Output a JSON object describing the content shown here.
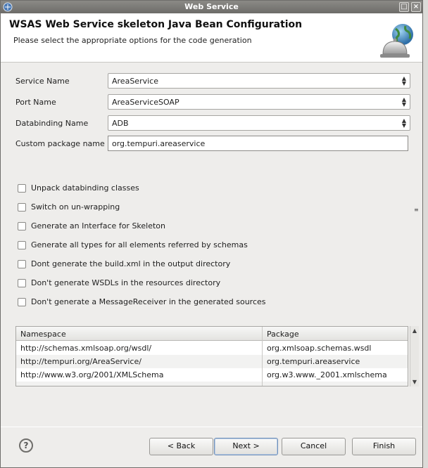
{
  "window": {
    "title": "Web Service"
  },
  "header": {
    "title": "WSAS Web Service skeleton Java Bean Configuration",
    "description": "Please select the appropriate options for the code generation"
  },
  "form": {
    "service_name_label": "Service Name",
    "service_name_value": "AreaService",
    "port_name_label": "Port Name",
    "port_name_value": "AreaServiceSOAP",
    "databinding_label": "Databinding Name",
    "databinding_value": "ADB",
    "package_label": "Custom package name",
    "package_value": "org.tempuri.areaservice"
  },
  "options": [
    {
      "label": "Unpack databinding classes",
      "checked": false
    },
    {
      "label": "Switch on un-wrapping",
      "checked": false
    },
    {
      "label": "Generate an Interface for Skeleton",
      "checked": false
    },
    {
      "label": "Generate all types for all elements referred by schemas",
      "checked": false
    },
    {
      "label": "Dont generate the build.xml in the output directory",
      "checked": false
    },
    {
      "label": "Don't generate WSDLs in the resources directory",
      "checked": false
    },
    {
      "label": "Don't generate a MessageReceiver in the generated sources",
      "checked": false
    }
  ],
  "table": {
    "headers": [
      "Namespace",
      "Package"
    ],
    "rows": [
      [
        "http://schemas.xmlsoap.org/wsdl/",
        "org.xmlsoap.schemas.wsdl"
      ],
      [
        "http://tempuri.org/AreaService/",
        "org.tempuri.areaservice"
      ],
      [
        "http://www.w3.org/2001/XMLSchema",
        "org.w3.www._2001.xmlschema"
      ]
    ]
  },
  "buttons": {
    "help": "?",
    "back": "< Back",
    "next": "Next >",
    "cancel": "Cancel",
    "finish": "Finish"
  },
  "icons": {
    "window": "app-icon",
    "banner": "globe-bell-icon"
  }
}
